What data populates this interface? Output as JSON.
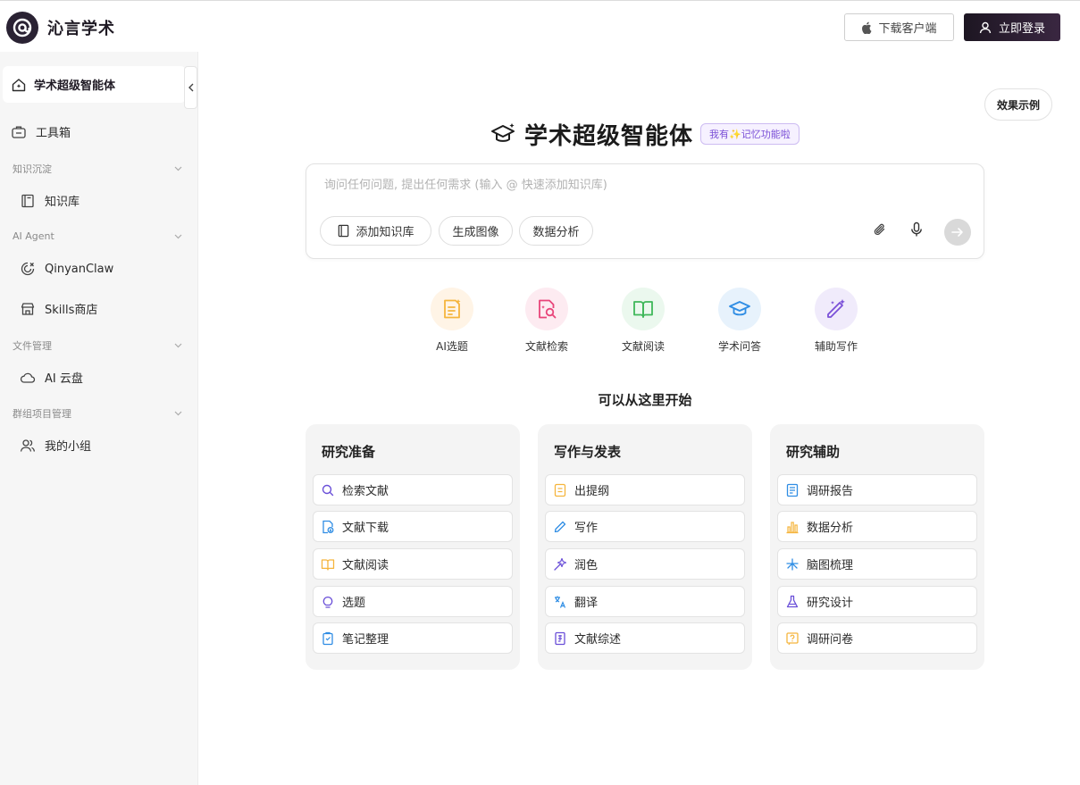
{
  "header": {
    "brand": "沁言学术",
    "download_label": "下载客户端",
    "login_label": "立即登录"
  },
  "sidebar": {
    "active_item": "学术超级智能体",
    "toolbox": "工具箱",
    "groups": [
      {
        "title": "知识沉淀",
        "items": [
          "知识库"
        ]
      },
      {
        "title": "AI Agent",
        "items": [
          "QinyanClaw",
          "Skills商店"
        ]
      },
      {
        "title": "文件管理",
        "items": [
          "AI 云盘"
        ]
      },
      {
        "title": "群组项目管理",
        "items": [
          "我的小组"
        ]
      }
    ]
  },
  "main": {
    "example_label": "效果示例",
    "title": "学术超级智能体",
    "memory_badge": "我有✨记忆功能啦",
    "chat": {
      "placeholder": "询问任何问题, 提出任何需求 (输入 @ 快速添加知识库)",
      "chips": [
        "添加知识库",
        "生成图像",
        "数据分析"
      ]
    },
    "features": [
      {
        "label": "AI选题",
        "icon": "note-sparkle-icon",
        "color": "#f5b53d",
        "bg": "#fff4e6"
      },
      {
        "label": "文献检索",
        "icon": "doc-search-icon",
        "color": "#e8457a",
        "bg": "#fdebf1"
      },
      {
        "label": "文献阅读",
        "icon": "open-book-icon",
        "color": "#3fb75a",
        "bg": "#ebf8ee"
      },
      {
        "label": "学术问答",
        "icon": "graduation-cap-icon",
        "color": "#2f8de4",
        "bg": "#e7f2fc"
      },
      {
        "label": "辅助写作",
        "icon": "magic-pen-icon",
        "color": "#7a50d8",
        "bg": "#f0ebfb"
      }
    ],
    "start_title": "可以从这里开始",
    "cards": [
      {
        "title": "研究准备",
        "items": [
          {
            "label": "检索文献",
            "icon": "search-icon",
            "color": "#6a4fd8"
          },
          {
            "label": "文献下载",
            "icon": "doc-download-icon",
            "color": "#2f8de4"
          },
          {
            "label": "文献阅读",
            "icon": "book-icon",
            "color": "#f5b53d"
          },
          {
            "label": "选题",
            "icon": "bulb-icon",
            "color": "#6a4fd8"
          },
          {
            "label": "笔记整理",
            "icon": "clipboard-icon",
            "color": "#2f8de4"
          }
        ]
      },
      {
        "title": "写作与发表",
        "items": [
          {
            "label": "出提纲",
            "icon": "outline-icon",
            "color": "#f5b53d"
          },
          {
            "label": "写作",
            "icon": "pencil-icon",
            "color": "#2f8de4"
          },
          {
            "label": "润色",
            "icon": "polish-icon",
            "color": "#6a4fd8"
          },
          {
            "label": "翻译",
            "icon": "translate-icon",
            "color": "#2f8de4"
          },
          {
            "label": "文献综述",
            "icon": "review-icon",
            "color": "#6a4fd8"
          }
        ]
      },
      {
        "title": "研究辅助",
        "items": [
          {
            "label": "调研报告",
            "icon": "report-icon",
            "color": "#2f8de4"
          },
          {
            "label": "数据分析",
            "icon": "bar-chart-icon",
            "color": "#f5b53d"
          },
          {
            "label": "脑图梳理",
            "icon": "mindmap-icon",
            "color": "#2f8de4"
          },
          {
            "label": "研究设计",
            "icon": "flask-icon",
            "color": "#6a4fd8"
          },
          {
            "label": "调研问卷",
            "icon": "questionnaire-icon",
            "color": "#f5b53d"
          }
        ]
      }
    ]
  }
}
